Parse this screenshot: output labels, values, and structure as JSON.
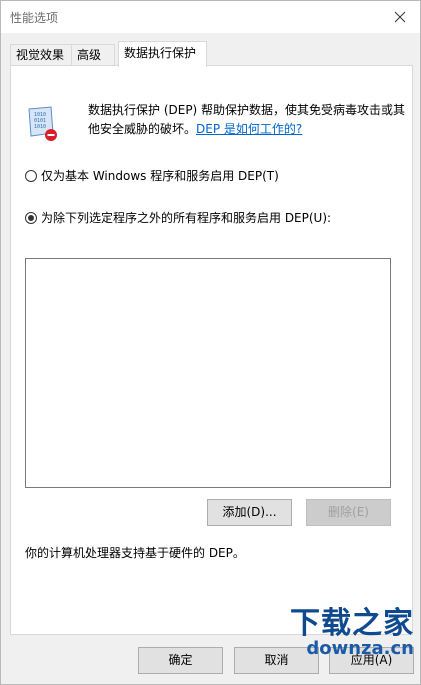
{
  "window": {
    "title": "性能选项"
  },
  "tabs": [
    {
      "label": "视觉效果"
    },
    {
      "label": "高级"
    },
    {
      "label": "数据执行保护"
    }
  ],
  "dep": {
    "icon": "dep-shield-binary-icon",
    "description": "数据执行保护 (DEP) 帮助保护数据，使其免受病毒攻击或其他安全威胁的破坏。",
    "link": "DEP 是如何工作的?"
  },
  "options": {
    "basic": "仅为基本 Windows 程序和服务启用 DEP(T)",
    "all_except": "为除下列选定程序之外的所有程序和服务启用 DEP(U):",
    "selected": "all_except"
  },
  "list_buttons": {
    "add": "添加(D)...",
    "remove": "删除(E)"
  },
  "support_text": "你的计算机处理器支持基于硬件的 DEP。",
  "footer": {
    "ok": "确定",
    "cancel": "取消",
    "apply": "应用(A)"
  },
  "watermark": {
    "line1": "下载之家",
    "line2": "downza.cn"
  },
  "colors": {
    "link": "#0066cc",
    "watermark": "#0f4a8f"
  }
}
